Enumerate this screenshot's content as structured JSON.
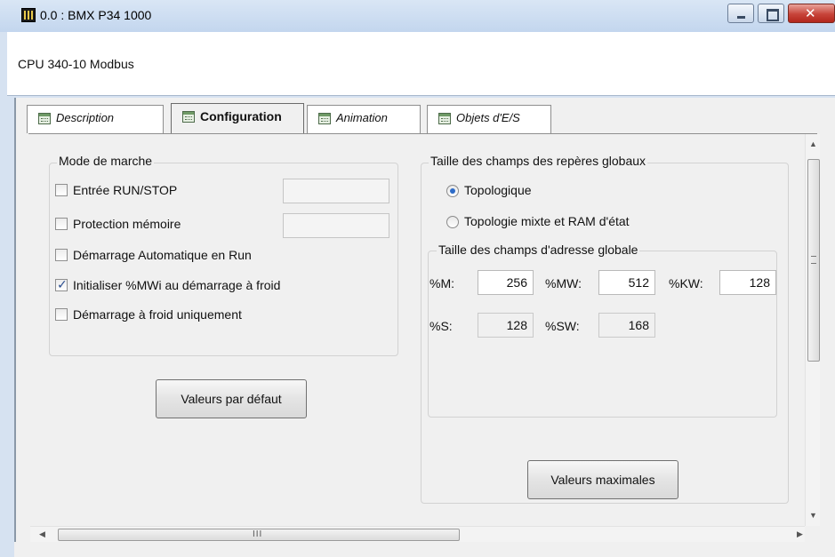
{
  "window": {
    "title": "0.0 : BMX P34 1000",
    "module_label": "CPU 340-10 Modbus",
    "icons": [
      "app-icon",
      "minimize-icon",
      "maximize-icon",
      "close-icon"
    ]
  },
  "tabs": [
    {
      "label": "Description",
      "icon": "tab-grid-icon",
      "active": false
    },
    {
      "label": "Configuration",
      "icon": "tab-grid-icon",
      "active": true
    },
    {
      "label": "Animation",
      "icon": "tab-grid-icon",
      "active": false
    },
    {
      "label": "Objets d'E/S",
      "icon": "tab-grid-icon",
      "active": false
    }
  ],
  "mode_de_marche": {
    "title": "Mode de marche",
    "options": [
      {
        "label": "Entrée RUN/STOP",
        "checked": false
      },
      {
        "label": "Protection mémoire",
        "checked": false
      },
      {
        "label": "Démarrage Automatique en Run",
        "checked": false
      },
      {
        "label": "Initialiser %MWi au démarrage à froid",
        "checked": true
      },
      {
        "label": "Démarrage à froid uniquement",
        "checked": false
      }
    ],
    "default_button": "Valeurs par défaut"
  },
  "reperes_globaux": {
    "title": "Taille des champs des repères globaux",
    "radios": [
      {
        "label": "Topologique",
        "selected": true
      },
      {
        "label": "Topologie mixte et RAM d'état",
        "selected": false
      }
    ],
    "adresse_globale": {
      "title": "Taille des champs d'adresse globale",
      "fields": {
        "M": {
          "label": "%M:",
          "value": "256"
        },
        "MW": {
          "label": "%MW:",
          "value": "512"
        },
        "KW": {
          "label": "%KW:",
          "value": "128"
        },
        "S": {
          "label": "%S:",
          "value": "128"
        },
        "SW": {
          "label": "%SW:",
          "value": "168"
        }
      }
    },
    "max_button": "Valeurs maximales"
  },
  "scrollbars": {
    "horizontal_grip": "III"
  }
}
